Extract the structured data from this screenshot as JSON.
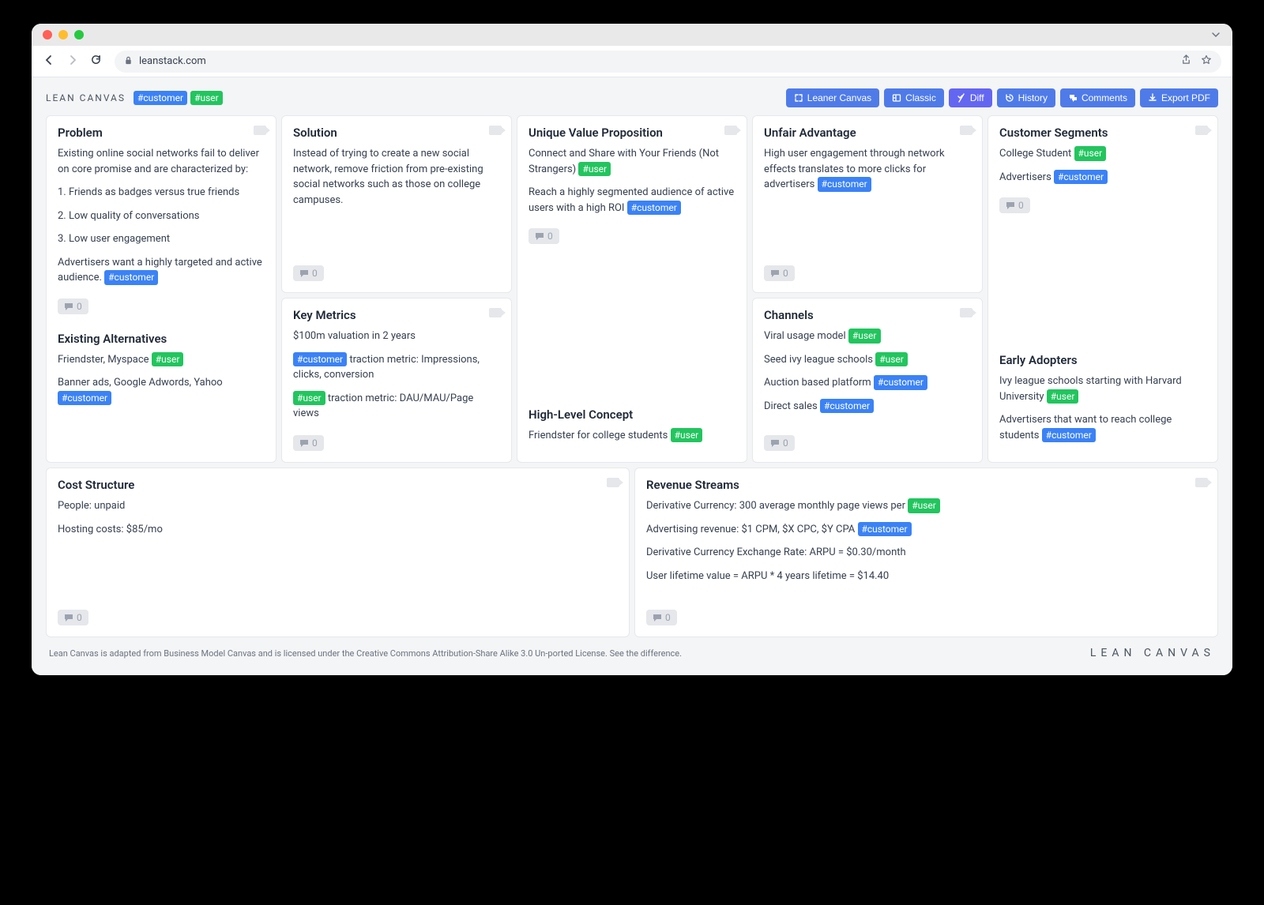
{
  "browser": {
    "url_host": "leanstack.com"
  },
  "header": {
    "brand": "LEAN CANVAS",
    "tags": {
      "customer": "#customer",
      "user": "#user"
    },
    "buttons": {
      "leaner": "Leaner Canvas",
      "classic": "Classic",
      "diff": "Diff",
      "history": "History",
      "comments": "Comments",
      "export": "Export PDF"
    }
  },
  "cards": {
    "problem": {
      "title": "Problem",
      "intro": "Existing online social networks fail to deliver on core promise and are characterized by:",
      "p1": "1. Friends as badges versus true friends",
      "p2": "2. Low quality of conversations",
      "p3": "3. Low user engagement",
      "adv": "Advertisers want a highly targeted and active audience.",
      "alt_title": "Existing Alternatives",
      "alt1": "Friendster, Myspace",
      "alt2": "Banner ads, Google Adwords, Yahoo",
      "comments": "0"
    },
    "solution": {
      "title": "Solution",
      "body": "Instead of trying to create a new social network, remove friction from pre-existing social networks such as those on college campuses.",
      "comments": "0"
    },
    "metrics": {
      "title": "Key Metrics",
      "l1": "$100m valuation in 2 years",
      "l2_suffix": " traction metric: Impressions, clicks, conversion",
      "l3_suffix": " traction metric: DAU/MAU/Page views",
      "comments": "0"
    },
    "uvp": {
      "title": "Unique Value Proposition",
      "l1": "Connect and Share with Your Friends (Not Strangers)",
      "l2": "Reach a highly segmented audience of active users with a high ROI",
      "hl_title": "High-Level Concept",
      "hl_body": "Friendster for college students",
      "comments": "0"
    },
    "unfair": {
      "title": "Unfair Advantage",
      "body": "High user engagement through network effects translates to more clicks for advertisers",
      "comments": "0"
    },
    "channels": {
      "title": "Channels",
      "c1": "Viral usage model",
      "c2": "Seed ivy league schools",
      "c3": "Auction based platform",
      "c4": "Direct sales",
      "comments": "0"
    },
    "segments": {
      "title": "Customer Segments",
      "s1": "College Student",
      "s2": "Advertisers",
      "ea_title": "Early Adopters",
      "ea1": "Ivy league schools starting with Harvard University",
      "ea2": "Advertisers that want to reach college students",
      "comments": "0"
    },
    "cost": {
      "title": "Cost Structure",
      "l1": "People: unpaid",
      "l2": "Hosting costs: $85/mo",
      "comments": "0"
    },
    "revenue": {
      "title": "Revenue Streams",
      "l1": "Derivative Currency: 300 average monthly page views per",
      "l2": "Advertising revenue: $1 CPM, $X CPC, $Y CPA",
      "l3": "Derivative Currency Exchange Rate: ARPU = $0.30/month",
      "l4": "User lifetime value = ARPU * 4 years lifetime = $14.40",
      "comments": "0"
    }
  },
  "footer": {
    "note": "Lean Canvas is adapted from Business Model Canvas and is licensed under the Creative Commons Attribution-Share Alike 3.0 Un-ported License. See the difference.",
    "logo": "LEAN CANVAS"
  }
}
